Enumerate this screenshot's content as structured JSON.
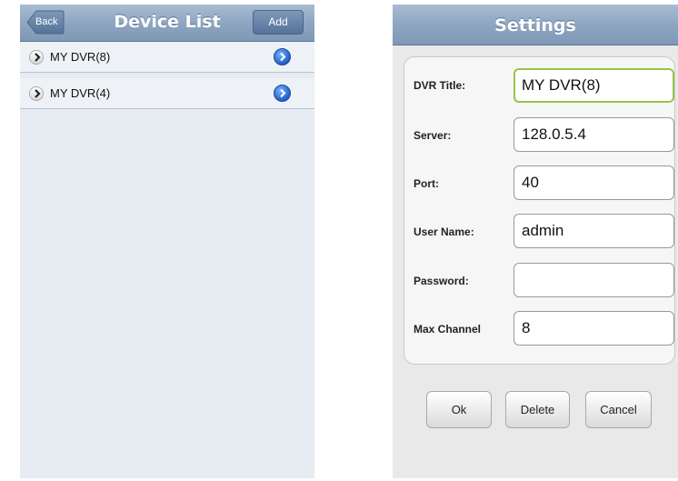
{
  "device_list": {
    "title": "Device List",
    "back_label": "Back",
    "add_label": "Add",
    "items": [
      {
        "label": "MY DVR(8)"
      },
      {
        "label": "MY DVR(4)"
      }
    ]
  },
  "settings": {
    "title": "Settings",
    "fields": [
      {
        "label": "DVR Title:",
        "value": "MY DVR(8)"
      },
      {
        "label": "Server:",
        "value": "128.0.5.4"
      },
      {
        "label": "Port:",
        "value": "40"
      },
      {
        "label": "User Name:",
        "value": "admin"
      },
      {
        "label": "Password:",
        "value": ""
      },
      {
        "label": "Max Channel",
        "value": "8"
      }
    ],
    "buttons": {
      "ok": "Ok",
      "delete": "Delete",
      "cancel": "Cancel"
    }
  },
  "colors": {
    "navbar": "#8ea6c1",
    "detail_disclosure": "#1f5fc4",
    "focus_border": "#98c44a"
  }
}
